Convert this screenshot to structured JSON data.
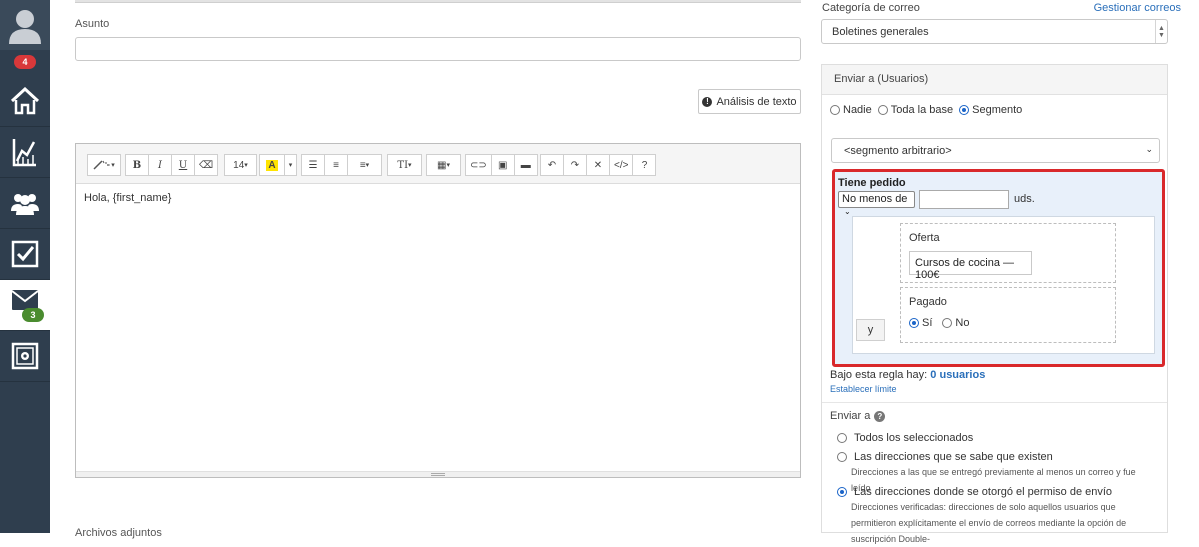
{
  "sidebar": {
    "avatar_icon": "user-avatar-icon",
    "notifications_badge": "4",
    "items": [
      {
        "name": "home",
        "icon": "home-icon"
      },
      {
        "name": "analytics",
        "icon": "chart-icon"
      },
      {
        "name": "contacts",
        "icon": "users-icon"
      },
      {
        "name": "tasks",
        "icon": "checkbox-icon"
      },
      {
        "name": "mail",
        "icon": "envelope-icon",
        "badge": "3",
        "active": true
      },
      {
        "name": "settings",
        "icon": "gear-icon"
      }
    ],
    "colors": {
      "bg": "#2f3e4e",
      "badge_red": "#d9383a",
      "badge_green": "#4a8c2f"
    }
  },
  "compose": {
    "subject_label": "Asunto",
    "subject_value": "",
    "text_analysis_button": "Análisis de texto",
    "editor": {
      "font_size": "14",
      "body_text": "Hola, {first_name}"
    },
    "attachments_label": "Archivos adjuntos"
  },
  "right": {
    "category_label": "Categoría de correo",
    "manage_link": "Gestionar correos",
    "category_value": "Boletines generales",
    "send_to_header": "Enviar a (Usuarios)",
    "recipient_options": [
      "Nadie",
      "Toda la base",
      "Segmento"
    ],
    "recipient_selected": "Segmento",
    "segment_value": "<segmento arbitrario>",
    "rule": {
      "title": "Tiene pedido",
      "comparator": "No menos de",
      "quantity": "",
      "unit": "uds.",
      "join_button": "y",
      "offer_label": "Oferta",
      "offer_value": "Cursos de cocina — 100€",
      "paid_label": "Pagado",
      "paid_options": [
        "Sí",
        "No"
      ],
      "paid_selected": "Sí"
    },
    "rule_count_prefix": "Bajo esta regla hay:",
    "rule_count_value": "0 usuarios",
    "set_limit_link": "Establecer límite",
    "send_to_label": "Enviar a",
    "send_options": [
      {
        "label": "Todos los seleccionados",
        "desc": ""
      },
      {
        "label": "Las direcciones que se sabe que existen",
        "desc": "Direcciones a las que se entregó previamente al menos un correo y fue leído"
      },
      {
        "label": "Las direcciones donde se otorgó el permiso de envío",
        "desc": "Direcciones verificadas: direcciones de solo aquellos usuarios que permitieron explícitamente el envío de correos mediante la opción de suscripción Double-"
      }
    ],
    "send_selected": "Las direcciones donde se otorgó el permiso de envío",
    "colors": {
      "link": "#2a6fba",
      "highlight_border": "#d9282b",
      "rule_bg": "#e8f0fa",
      "radio_on": "#1a64c8"
    }
  }
}
